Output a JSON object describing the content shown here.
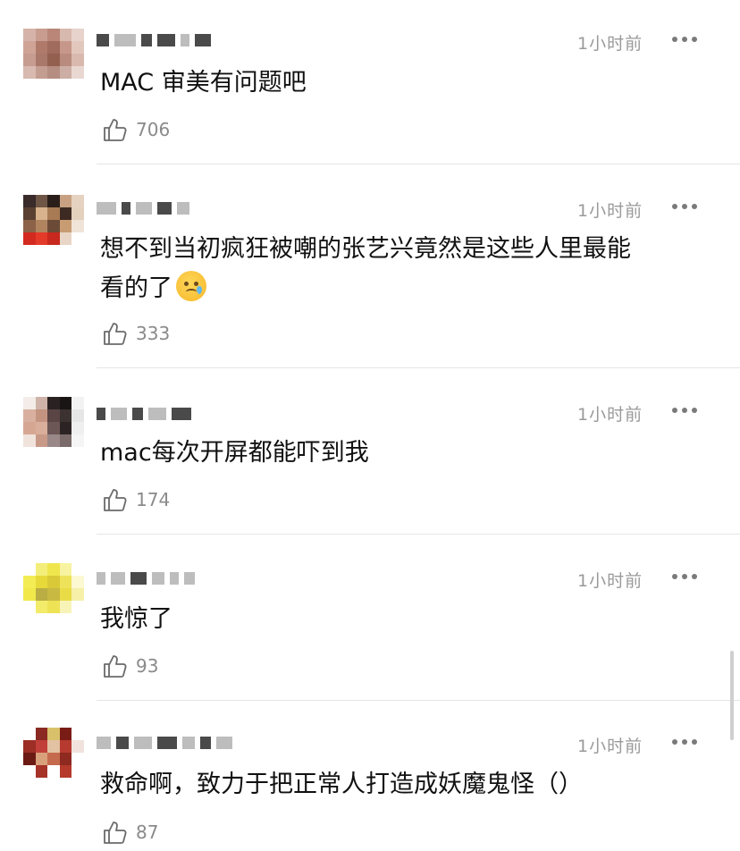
{
  "comments": [
    {
      "time": "1小时前",
      "text": "MAC 审美有问题吧",
      "likes": "706"
    },
    {
      "time": "1小时前",
      "text_line1": "想不到当初疯狂被嘲的张艺兴竟然是这些人里最能",
      "text_line2": "看的了",
      "emoji": "crying-face",
      "likes": "333"
    },
    {
      "time": "1小时前",
      "text": "mac每次开屏都能吓到我",
      "likes": "174"
    },
    {
      "time": "1小时前",
      "text": "我惊了",
      "likes": "93"
    },
    {
      "time": "1小时前",
      "text": "救命啊，致力于把正常人打造成妖魔鬼怪（）",
      "likes": "87"
    }
  ],
  "icons": {
    "like": "thumbs-up-icon",
    "more": "more-dots-icon"
  },
  "colors": {
    "text": "#111111",
    "muted": "#9a9a9a",
    "divider": "#e6e6e6"
  }
}
